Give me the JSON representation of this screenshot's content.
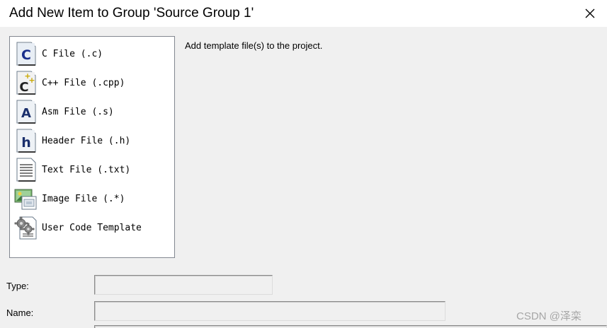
{
  "window": {
    "title": "Add New Item to Group 'Source Group 1'",
    "close_icon": "close-x-icon"
  },
  "item_list": [
    {
      "label": "C File (.c)",
      "icon": "c-file-icon"
    },
    {
      "label": "C++ File (.cpp)",
      "icon": "cpp-file-icon"
    },
    {
      "label": "Asm File (.s)",
      "icon": "asm-file-icon"
    },
    {
      "label": "Header File (.h)",
      "icon": "header-file-icon"
    },
    {
      "label": "Text File (.txt)",
      "icon": "text-file-icon"
    },
    {
      "label": "Image File (.*)",
      "icon": "image-file-icon"
    },
    {
      "label": "User Code Template",
      "icon": "gear-template-icon"
    }
  ],
  "description": "Add template file(s) to the project.",
  "form": {
    "type_label": "Type:",
    "type_value": "",
    "name_label": "Name:",
    "name_value": ""
  },
  "watermark": "CSDN @泽栾"
}
